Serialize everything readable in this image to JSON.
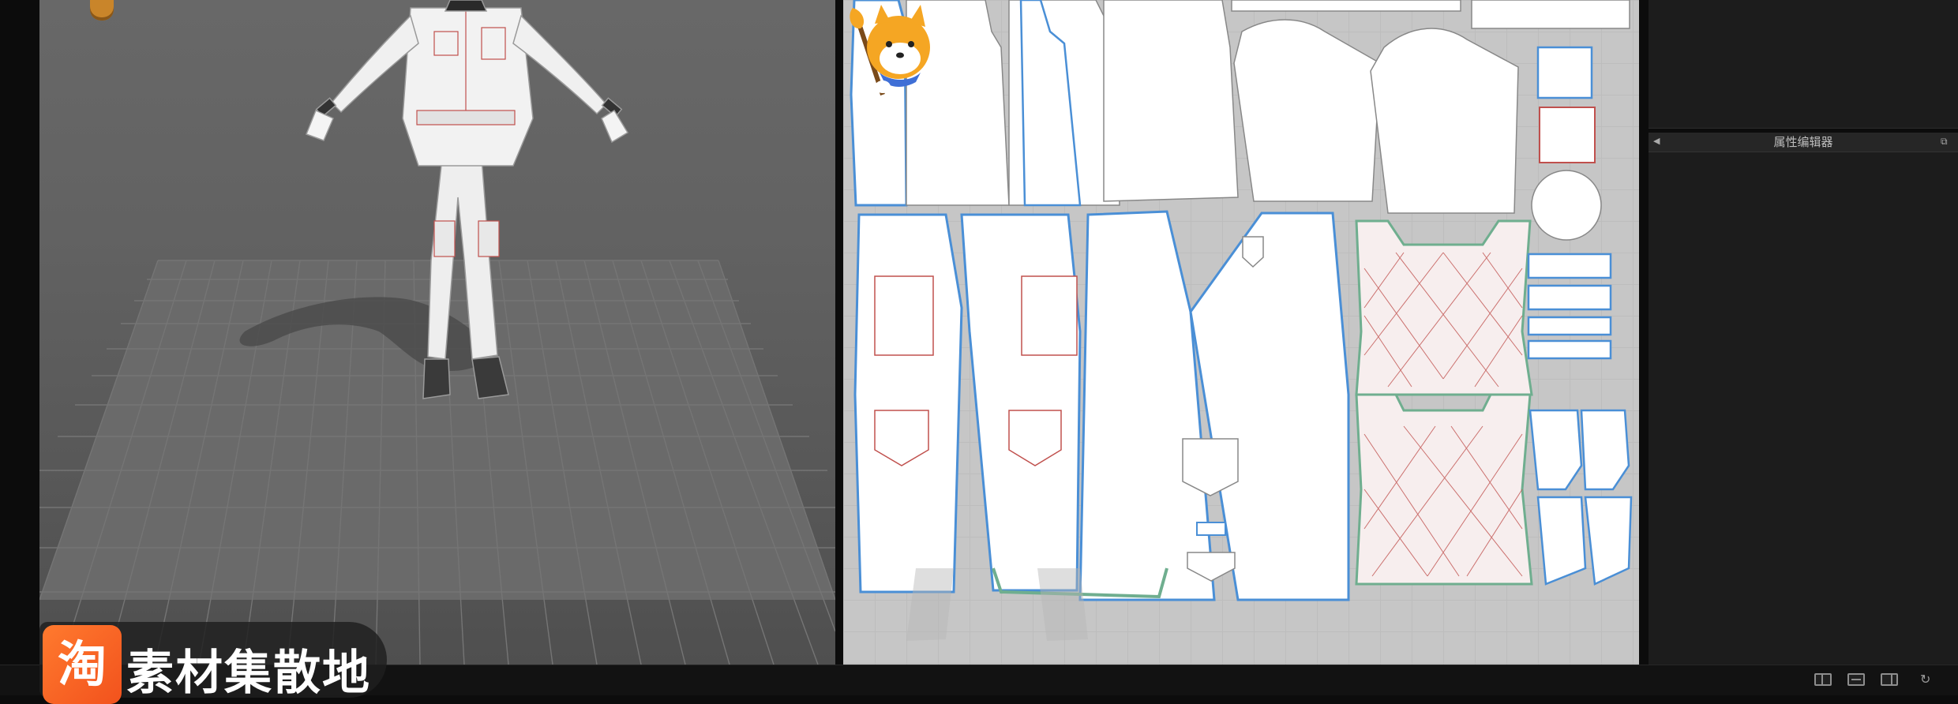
{
  "panels": {
    "property_editor_title": "属性编辑器",
    "collapse_icon": "triangle-left",
    "popout_icon": "popout"
  },
  "status_bar": {
    "layout_buttons": [
      "3d-view",
      "split-view",
      "2d-view"
    ],
    "refresh_icon": "refresh"
  },
  "watermark": {
    "logo_char": "淘",
    "text": "素材集散地"
  },
  "colors": {
    "viewport_bg": "#626262",
    "pattern_bg": "#c6c6c6",
    "panel_bg": "#1c1c1c",
    "seam_blue": "#4a8fd6",
    "seam_green": "#6fae8f",
    "stitch_red": "#c0504d",
    "watermark_orange": "#f2521d"
  }
}
